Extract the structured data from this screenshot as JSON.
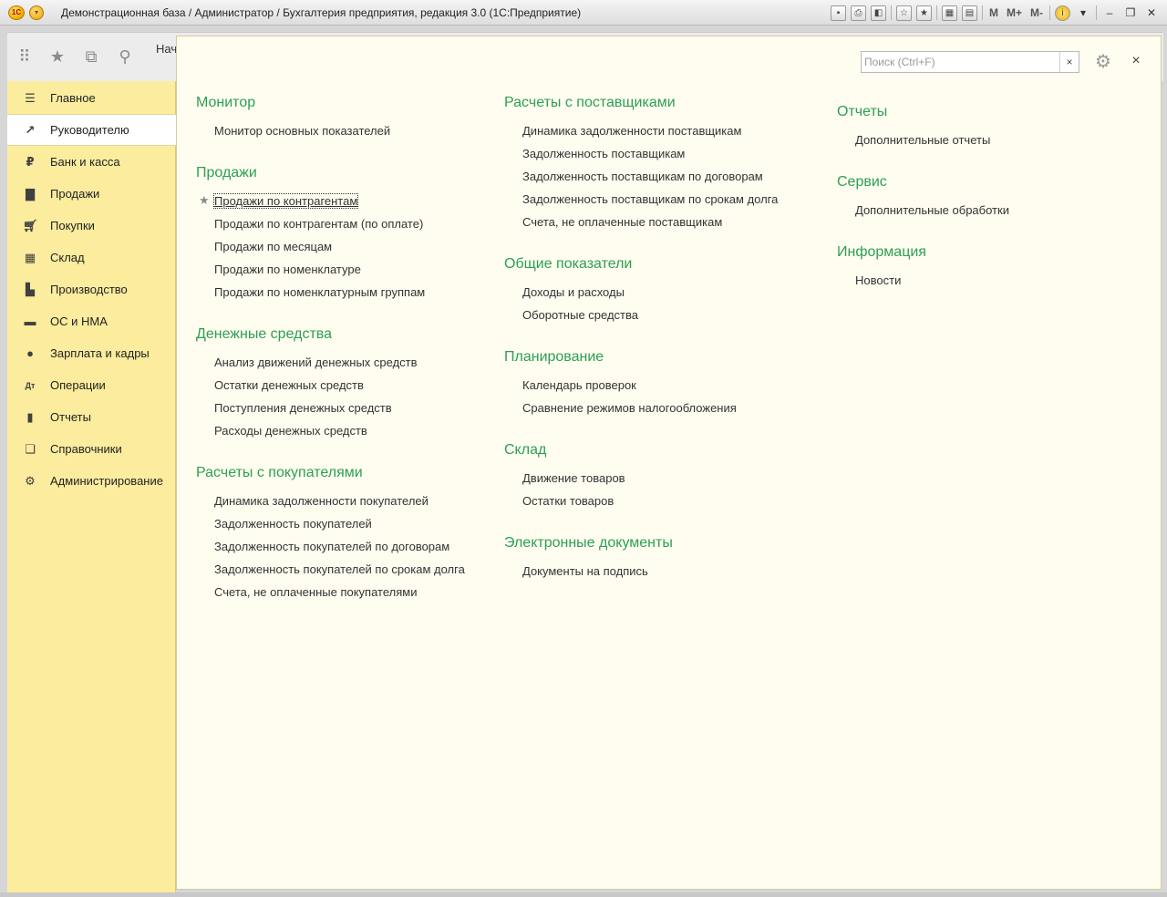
{
  "window": {
    "title": "Демонстрационная база / Администратор / Бухгалтерия предприятия, редакция 3.0  (1С:Предприятие)",
    "logo_text": "1С",
    "toolbar_text": [
      "M",
      "M+",
      "M-"
    ]
  },
  "tabs_strip": {
    "home_tab_label": "Нач"
  },
  "search": {
    "placeholder": "Поиск (Ctrl+F)",
    "value": ""
  },
  "sidebar": {
    "items": [
      {
        "label": "Главное",
        "icon": "menu-lines-icon"
      },
      {
        "label": "Руководителю",
        "icon": "trend-chart-icon",
        "active": true
      },
      {
        "label": "Банк и касса",
        "icon": "ruble-coin-icon"
      },
      {
        "label": "Продажи",
        "icon": "shopping-bag-icon"
      },
      {
        "label": "Покупки",
        "icon": "shopping-cart-icon"
      },
      {
        "label": "Склад",
        "icon": "warehouse-grid-icon"
      },
      {
        "label": "Производство",
        "icon": "factory-icon"
      },
      {
        "label": "ОС и НМА",
        "icon": "truck-icon"
      },
      {
        "label": "Зарплата и кадры",
        "icon": "person-icon"
      },
      {
        "label": "Операции",
        "icon": "dt-kt-icon"
      },
      {
        "label": "Отчеты",
        "icon": "bar-chart-icon"
      },
      {
        "label": "Справочники",
        "icon": "books-icon"
      },
      {
        "label": "Администрирование",
        "icon": "gear-icon"
      }
    ]
  },
  "columns": [
    {
      "sections": [
        {
          "title": "Монитор",
          "links": [
            "Монитор основных показателей"
          ]
        },
        {
          "title": "Продажи",
          "links": [
            "Продажи по контрагентам",
            "Продажи по контрагентам (по оплате)",
            "Продажи по месяцам",
            "Продажи по номенклатуре",
            "Продажи по номенклатурным группам"
          ]
        },
        {
          "title": "Денежные средства",
          "links": [
            "Анализ движений денежных средств",
            "Остатки денежных средств",
            "Поступления денежных средств",
            "Расходы денежных средств"
          ]
        },
        {
          "title": "Расчеты с покупателями",
          "links": [
            "Динамика задолженности покупателей",
            "Задолженность покупателей",
            "Задолженность покупателей по договорам",
            "Задолженность покупателей по срокам долга",
            "Счета, не оплаченные покупателями"
          ]
        }
      ]
    },
    {
      "sections": [
        {
          "title": "Расчеты с поставщиками",
          "links": [
            "Динамика задолженности поставщикам",
            "Задолженность поставщикам",
            "Задолженность поставщикам по договорам",
            "Задолженность поставщикам по срокам долга",
            "Счета, не оплаченные поставщикам"
          ]
        },
        {
          "title": "Общие показатели",
          "links": [
            "Доходы и расходы",
            "Оборотные средства"
          ]
        },
        {
          "title": "Планирование",
          "links": [
            "Календарь проверок",
            "Сравнение режимов налогообложения"
          ]
        },
        {
          "title": "Склад",
          "links": [
            "Движение товаров",
            "Остатки товаров"
          ]
        },
        {
          "title": "Электронные документы",
          "links": [
            "Документы на подпись"
          ]
        }
      ]
    },
    {
      "sections": [
        {
          "title": "Отчеты",
          "links": [
            "Дополнительные отчеты"
          ]
        },
        {
          "title": "Сервис",
          "links": [
            "Дополнительные обработки"
          ]
        },
        {
          "title": "Информация",
          "links": [
            "Новости"
          ]
        }
      ]
    }
  ],
  "colors": {
    "section_title": "#2d9f52",
    "sidebar_bg": "#fbec9e",
    "panel_bg": "#fffdf0"
  }
}
